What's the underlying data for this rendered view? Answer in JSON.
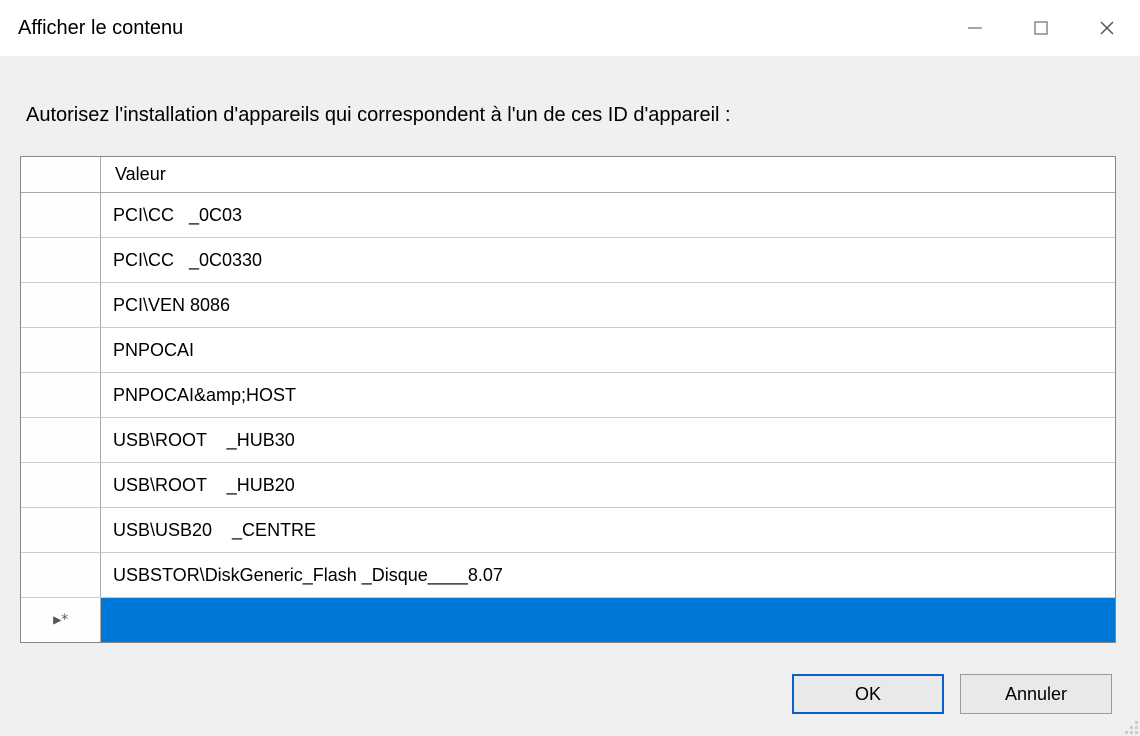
{
  "window": {
    "title": "Afficher le contenu"
  },
  "instruction": "Autorisez l'installation d'appareils qui correspondent à l'un de ces ID d'appareil :",
  "grid": {
    "column_header": "Valeur",
    "row_indicator": "▶*",
    "rows": [
      "PCI\\CC   _0C03",
      "PCI\\CC   _0C0330",
      "PCI\\VEN 8086",
      "PNPOCAI",
      "PNPOCAI&amp;HOST",
      "USB\\ROOT    _HUB30",
      "USB\\ROOT    _HUB20",
      "USB\\USB20    _CENTRE",
      "USBSTOR\\DiskGeneric_Flash _Disque____8.07"
    ],
    "new_row_value": ""
  },
  "buttons": {
    "ok": "OK",
    "cancel": "Annuler"
  }
}
